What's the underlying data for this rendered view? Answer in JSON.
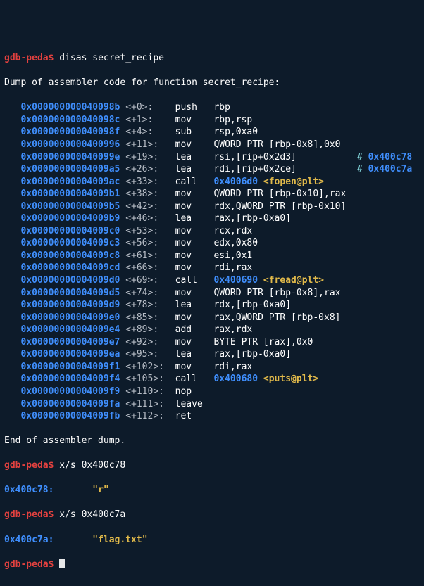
{
  "prompt": "gdb-peda$",
  "cmds": {
    "disas": "disas secret_recipe",
    "xs1": "x/s 0x400c78",
    "xs2": "x/s 0x400c7a",
    "blank": ""
  },
  "dump_header": "Dump of assembler code for function secret_recipe:",
  "dump_footer": "End of assembler dump.",
  "lines": [
    {
      "addr": "0x000000000040098b",
      "off": "<+0>:",
      "op": "push",
      "args": "rbp"
    },
    {
      "addr": "0x000000000040098c",
      "off": "<+1>:",
      "op": "mov",
      "args": "rbp,rsp"
    },
    {
      "addr": "0x000000000040098f",
      "off": "<+4>:",
      "op": "sub",
      "args": "rsp,0xa0"
    },
    {
      "addr": "0x0000000000400996",
      "off": "<+11>:",
      "op": "mov",
      "args": "QWORD PTR [rbp-0x8],0x0"
    },
    {
      "addr": "0x000000000040099e",
      "off": "<+19>:",
      "op": "lea",
      "args": "rsi,[rip+0x2d3]",
      "cmt": "0x400c78"
    },
    {
      "addr": "0x00000000004009a5",
      "off": "<+26>:",
      "op": "lea",
      "args": "rdi,[rip+0x2ce]",
      "cmt": "0x400c7a"
    },
    {
      "addr": "0x00000000004009ac",
      "off": "<+33>:",
      "op": "call",
      "call_addr": "0x4006d0",
      "call_sym": "<fopen@plt>"
    },
    {
      "addr": "0x00000000004009b1",
      "off": "<+38>:",
      "op": "mov",
      "args": "QWORD PTR [rbp-0x10],rax"
    },
    {
      "addr": "0x00000000004009b5",
      "off": "<+42>:",
      "op": "mov",
      "args": "rdx,QWORD PTR [rbp-0x10]"
    },
    {
      "addr": "0x00000000004009b9",
      "off": "<+46>:",
      "op": "lea",
      "args": "rax,[rbp-0xa0]"
    },
    {
      "addr": "0x00000000004009c0",
      "off": "<+53>:",
      "op": "mov",
      "args": "rcx,rdx"
    },
    {
      "addr": "0x00000000004009c3",
      "off": "<+56>:",
      "op": "mov",
      "args": "edx,0x80"
    },
    {
      "addr": "0x00000000004009c8",
      "off": "<+61>:",
      "op": "mov",
      "args": "esi,0x1"
    },
    {
      "addr": "0x00000000004009cd",
      "off": "<+66>:",
      "op": "mov",
      "args": "rdi,rax"
    },
    {
      "addr": "0x00000000004009d0",
      "off": "<+69>:",
      "op": "call",
      "call_addr": "0x400690",
      "call_sym": "<fread@plt>"
    },
    {
      "addr": "0x00000000004009d5",
      "off": "<+74>:",
      "op": "mov",
      "args": "QWORD PTR [rbp-0x8],rax"
    },
    {
      "addr": "0x00000000004009d9",
      "off": "<+78>:",
      "op": "lea",
      "args": "rdx,[rbp-0xa0]"
    },
    {
      "addr": "0x00000000004009e0",
      "off": "<+85>:",
      "op": "mov",
      "args": "rax,QWORD PTR [rbp-0x8]"
    },
    {
      "addr": "0x00000000004009e4",
      "off": "<+89>:",
      "op": "add",
      "args": "rax,rdx"
    },
    {
      "addr": "0x00000000004009e7",
      "off": "<+92>:",
      "op": "mov",
      "args": "BYTE PTR [rax],0x0"
    },
    {
      "addr": "0x00000000004009ea",
      "off": "<+95>:",
      "op": "lea",
      "args": "rax,[rbp-0xa0]"
    },
    {
      "addr": "0x00000000004009f1",
      "off": "<+102>:",
      "op": "mov",
      "args": "rdi,rax"
    },
    {
      "addr": "0x00000000004009f4",
      "off": "<+105>:",
      "op": "call",
      "call_addr": "0x400680",
      "call_sym": "<puts@plt>"
    },
    {
      "addr": "0x00000000004009f9",
      "off": "<+110>:",
      "op": "nop",
      "args": ""
    },
    {
      "addr": "0x00000000004009fa",
      "off": "<+111>:",
      "op": "leave",
      "args": ""
    },
    {
      "addr": "0x00000000004009fb",
      "off": "<+112>:",
      "op": "ret",
      "args": ""
    }
  ],
  "xs": [
    {
      "addr": "0x400c78:",
      "val": "\"r\""
    },
    {
      "addr": "0x400c7a:",
      "val": "\"flag.txt\""
    }
  ],
  "colors": {
    "bg": "#0d1b2a",
    "red": "#e2413f",
    "blue": "#3f8efc",
    "yellow": "#e0b94a",
    "cyan": "#7fd1d6",
    "fg": "#e6e7e8"
  }
}
